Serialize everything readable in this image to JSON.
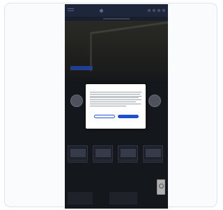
{
  "site": {
    "brand": ""
  },
  "hero": {
    "cta_label": ""
  },
  "sections": {
    "services_title": "",
    "products_title": ""
  },
  "consent": {
    "title": "",
    "option_left": "",
    "option_right": "",
    "reject_label": "",
    "accept_label": "",
    "links": [
      "",
      "",
      ""
    ]
  },
  "colors": {
    "page_bg": "#ffffff",
    "card_bg": "#fafbfd",
    "header_bg": "#2a3552",
    "primary_button": "#1f4fd1",
    "hero_cta": "#2f57c9"
  }
}
